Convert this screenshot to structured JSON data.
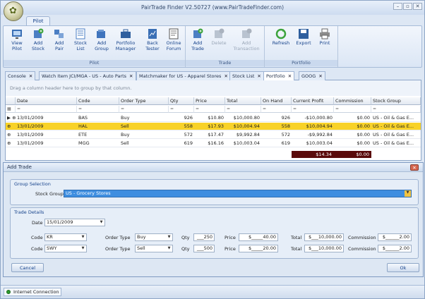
{
  "window": {
    "title": "PairTrade Finder V2.50727 (www.PairTradeFinder.com)"
  },
  "ribbon": {
    "tab": "Pilot",
    "groups": [
      {
        "label": "Pilot",
        "buttons": [
          "View Pilot",
          "Add Stock",
          "Add Pair",
          "Stock List",
          "Add Group",
          "Portfolio Manager",
          "Back Tester",
          "Online Forum"
        ]
      },
      {
        "label": "Trade",
        "buttons": [
          "Add Trade",
          "Delete",
          "Add Transaction"
        ]
      },
      {
        "label": "Portfolio",
        "buttons": [
          "Refresh",
          "Export",
          "Print"
        ]
      }
    ]
  },
  "doc_tabs": [
    "Console",
    "Watch Item JCI/MGA - US - Auto Parts",
    "Matchmaker for US - Apparel Stores",
    "Stock List",
    "Portfolio",
    "GOOG"
  ],
  "grid": {
    "group_hint": "Drag a column header here to group by that column.",
    "columns": [
      "Date",
      "Code",
      "Order Type",
      "Qty",
      "Price",
      "Total",
      "On Hand",
      "Current Profit",
      "Commission",
      "Stock Group"
    ],
    "rows": [
      [
        "13/01/2009",
        "BAS",
        "Buy",
        "926",
        "$10.80",
        "$10,000.80",
        "926",
        "-$10,000.80",
        "$0.00",
        "US - Oil & Gas E..."
      ],
      [
        "13/01/2009",
        "HAL",
        "Sell",
        "558",
        "$17.93",
        "$10,004.94",
        "558",
        "$10,004.94",
        "$0.00",
        "US - Oil & Gas E..."
      ],
      [
        "13/01/2009",
        "ETE",
        "Buy",
        "572",
        "$17.47",
        "$9,992.84",
        "572",
        "-$9,992.84",
        "$0.00",
        "US - Oil & Gas E..."
      ],
      [
        "13/01/2009",
        "MGG",
        "Sell",
        "619",
        "$16.16",
        "$10,003.04",
        "619",
        "$10,003.04",
        "$0.00",
        "US - Oil & Gas E..."
      ]
    ],
    "totals": {
      "current_profit": "$14.34",
      "commission": "$0.00"
    }
  },
  "dialog": {
    "title": "Add Trade",
    "group_selection": {
      "title": "Group Selection",
      "label": "Stock Group",
      "value": "US - Grocery Stores"
    },
    "trade_details": {
      "title": "Trade Details",
      "date_label": "Date",
      "date": "15/01/2009",
      "labels": {
        "code": "Code",
        "order_type": "Order Type",
        "qty": "Qty",
        "price": "Price",
        "total": "Total",
        "commission": "Commission"
      },
      "lines": [
        {
          "code": "KR",
          "order_type": "Buy",
          "qty": "___250",
          "price": "$_____40.00",
          "total": "$___10,000.00",
          "commission": "$______2.00"
        },
        {
          "code": "SWY",
          "order_type": "Sell",
          "qty": "___500",
          "price": "$_____20.00",
          "total": "$___10,000.00",
          "commission": "$______2.00"
        }
      ]
    },
    "cancel": "Cancel",
    "ok": "Ok"
  },
  "status": {
    "text": "Internet Connection",
    "color": "#2e9a2e"
  }
}
